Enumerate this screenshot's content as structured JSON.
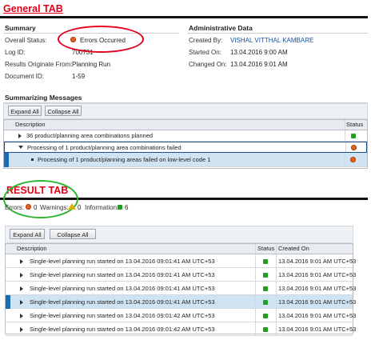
{
  "general_tab": {
    "title": "General TAB",
    "summary_heading": "Summary",
    "admin_heading": "Administrative Data",
    "summary_fields": [
      {
        "label": "Overall Status:",
        "value": "Errors Occurred"
      },
      {
        "label": "Log ID:",
        "value": "700731"
      },
      {
        "label": "Results Originate From:",
        "value": "Planning Run"
      },
      {
        "label": "Document ID:",
        "value": "1-59"
      }
    ],
    "admin_fields": [
      {
        "label": "Created By:",
        "value": "VISHAL VITTHAL KAMBARE"
      },
      {
        "label": "Started On:",
        "value": "13.04.2016 9:00 AM"
      },
      {
        "label": "Changed On:",
        "value": "13.04.2016 9:01 AM"
      }
    ],
    "messages_heading": "Summarizing Messages",
    "expand_label": "Expand All",
    "collapse_label": "Collapse All",
    "col_description": "Description",
    "col_status": "Status",
    "rows": [
      {
        "text": "36  product/planning area combinations planned",
        "status": "green"
      },
      {
        "text": "Processing of 1  product/planning area combinations failed",
        "status": "red"
      },
      {
        "text": "Processing of 1  product/planning areas failed on low-level code 1",
        "status": "red"
      }
    ],
    "colors": {
      "tab_title": "#e3001b",
      "link": "#1a4fa0",
      "selection": "#cfe3f3",
      "status_ok": "#20a020",
      "status_error": "#e0641e"
    }
  },
  "result_tab": {
    "title": "RESULT TAB",
    "errors_label": "Errors:",
    "errors_count": "0",
    "warnings_label": "Warnings:",
    "warnings_count": "0",
    "information_label": "Information:",
    "information_count": "6",
    "expand_label": "Expand All",
    "collapse_label": "Collapse All",
    "col_description": "Description",
    "col_status": "Status",
    "col_created": "Created On",
    "rows": [
      {
        "text": "Single-level planning run started on 13.04.2016 09:01:41 AM UTC+53",
        "created": "13.04.2016 9:01 AM UTC+53",
        "selected": false
      },
      {
        "text": "Single-level planning run started on 13.04.2016 09:01:41 AM UTC+53",
        "created": "13.04.2016 9:01 AM UTC+53",
        "selected": false
      },
      {
        "text": "Single-level planning run started on 13.04.2016 09:01:41 AM UTC+53",
        "created": "13.04.2016 9:01 AM UTC+53",
        "selected": false
      },
      {
        "text": "Single-level planning run started on 13.04.2016 09:01:41 AM UTC+53",
        "created": "13.04.2016 9:01 AM UTC+53",
        "selected": true
      },
      {
        "text": "Single-level planning run started on 13.04.2016 09:01:42 AM UTC+53",
        "created": "13.04.2016 9:01 AM UTC+53",
        "selected": false
      },
      {
        "text": "Single-level planning run started on 13.04.2016 09:01:42 AM UTC+53",
        "created": "13.04.2016 9:01 AM UTC+53",
        "selected": false
      }
    ]
  }
}
